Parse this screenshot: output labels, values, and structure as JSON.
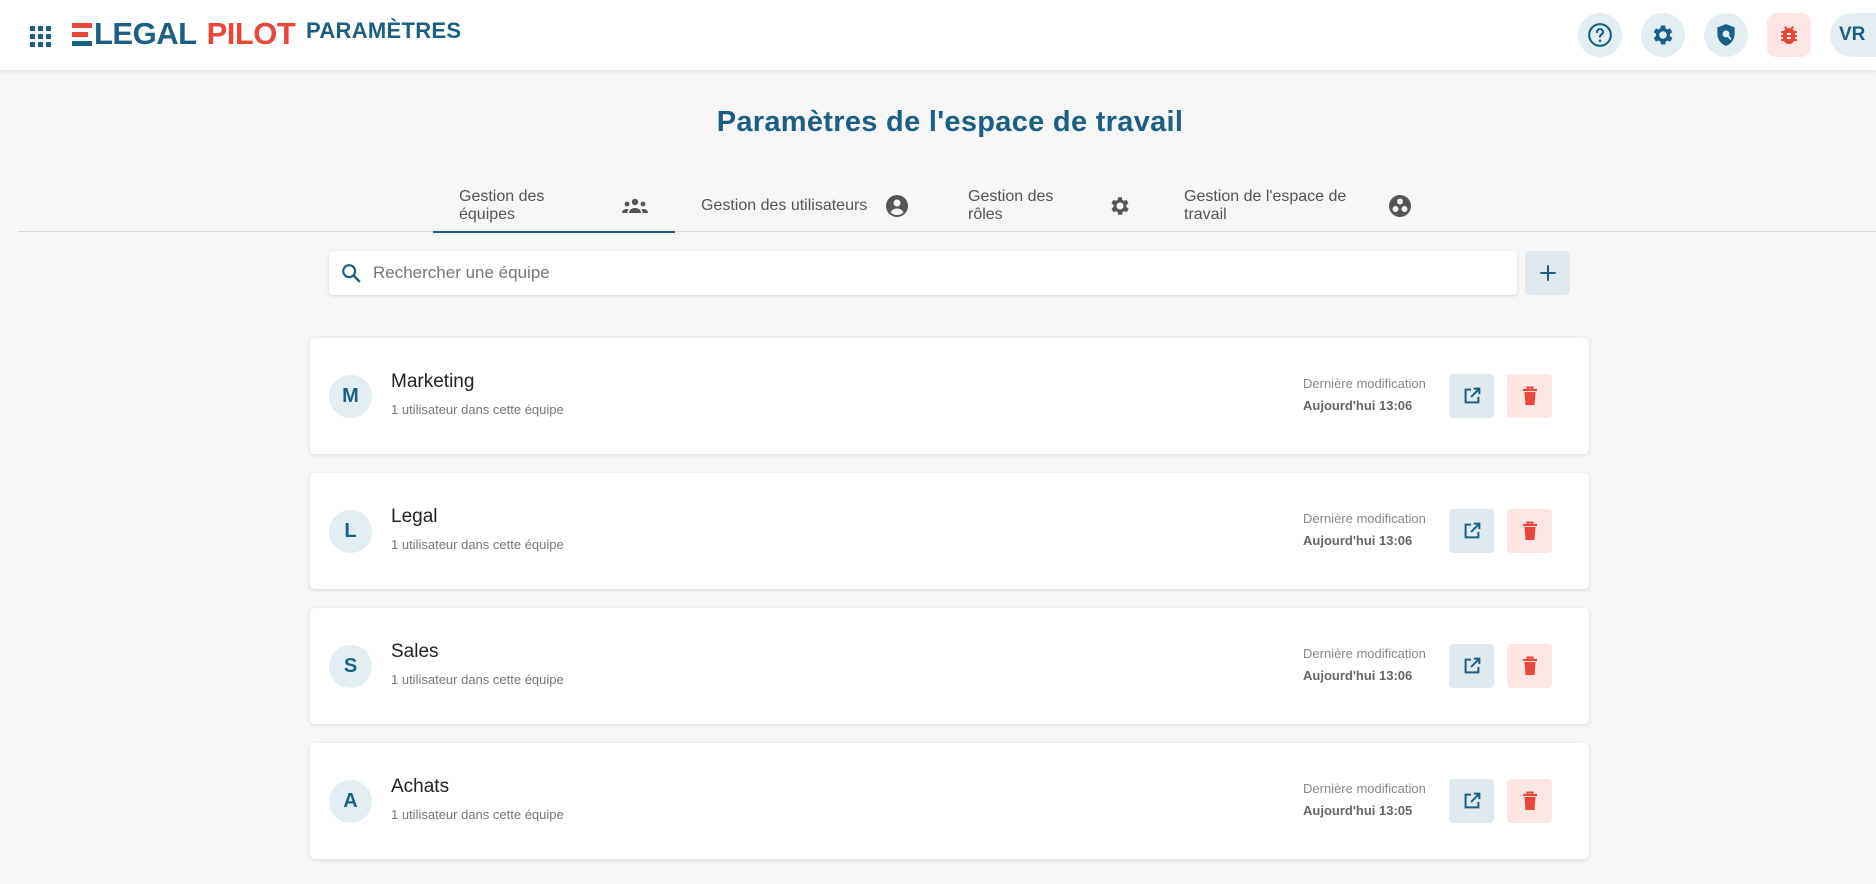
{
  "header": {
    "logo": {
      "part1": "LEGAL",
      "part2": "PILOT"
    },
    "app_name": "PARAMÈTRES",
    "icons": [
      "apps-grid-icon",
      "help-icon",
      "settings-gear-icon",
      "shield-icon",
      "bug-icon"
    ],
    "user_initials": "VR"
  },
  "page": {
    "title": "Paramètres de l'espace de travail"
  },
  "tabs": [
    {
      "label": "Gestion des équipes",
      "icon": "groups-icon",
      "active": true
    },
    {
      "label": "Gestion des utilisateurs",
      "icon": "account-circle-icon",
      "active": false
    },
    {
      "label": "Gestion des rôles",
      "icon": "gear-icon",
      "active": false
    },
    {
      "label": "Gestion de l'espace de travail",
      "icon": "workspaces-icon",
      "active": false
    }
  ],
  "search": {
    "placeholder": "Rechercher une équipe",
    "value": ""
  },
  "teams": [
    {
      "initial": "M",
      "name": "Marketing",
      "members": "1 utilisateur dans cette équipe",
      "modified_label": "Dernière modification",
      "modified_date": "Aujourd'hui 13:06"
    },
    {
      "initial": "L",
      "name": "Legal",
      "members": "1 utilisateur dans cette équipe",
      "modified_label": "Dernière modification",
      "modified_date": "Aujourd'hui 13:06"
    },
    {
      "initial": "S",
      "name": "Sales",
      "members": "1 utilisateur dans cette équipe",
      "modified_label": "Dernière modification",
      "modified_date": "Aujourd'hui 13:06"
    },
    {
      "initial": "A",
      "name": "Achats",
      "members": "1 utilisateur dans cette équipe",
      "modified_label": "Dernière modification",
      "modified_date": "Aujourd'hui 13:05"
    }
  ],
  "colors": {
    "primary": "#1c5f82",
    "accent_red": "#e8473a",
    "light_blue_bg": "#e3eef3",
    "light_red_bg": "#fce6e4",
    "page_bg": "#f6f6f6"
  }
}
